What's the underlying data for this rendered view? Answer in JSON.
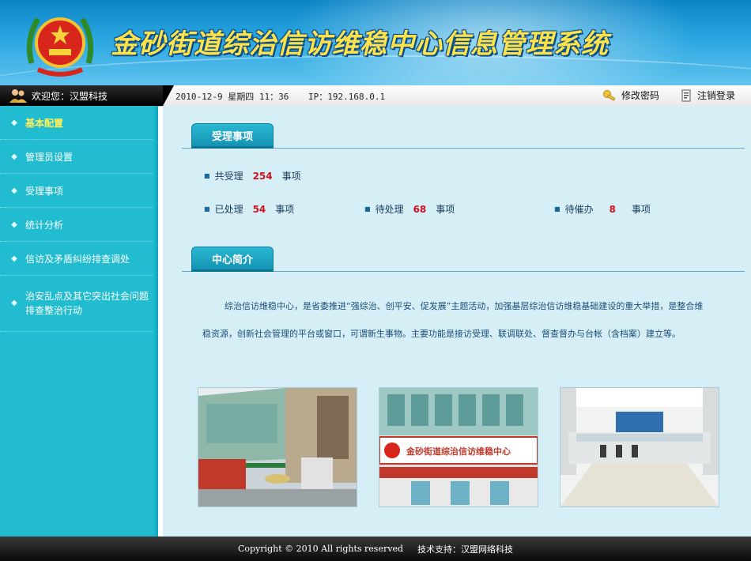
{
  "header": {
    "title": "金砂街道综治信访维稳中心信息管理系统"
  },
  "topbar": {
    "welcome": "欢迎您：汉盟科技",
    "datetime": "2010-12-9 星期四 11：36",
    "ip": "IP：192.168.0.1",
    "change_password": "修改密码",
    "logout": "注销登录"
  },
  "sidebar": {
    "items": [
      {
        "label": "基本配置",
        "active": true
      },
      {
        "label": "管理员设置"
      },
      {
        "label": "受理事项"
      },
      {
        "label": "统计分析"
      },
      {
        "label": "信访及矛盾纠纷排查调处"
      },
      {
        "label": "治安乱点及其它突出社会问题排查整治行动"
      }
    ]
  },
  "main": {
    "section1_title": "受理事项",
    "stats": {
      "total": {
        "prefix": "共受理",
        "value": "254",
        "suffix": "事项"
      },
      "handled": {
        "prefix": "已处理",
        "value": "54",
        "suffix": "事项"
      },
      "pending": {
        "prefix": "待处理",
        "value": "68",
        "suffix": "事项"
      },
      "urged": {
        "prefix": "待催办",
        "value": "8",
        "suffix": "事项"
      }
    },
    "section2_title": "中心简介",
    "intro": "综治信访维稳中心，是省委推进“强综治、创平安、促发展”主题活动，加强基层综治信访维稳基础建设的重大举措，是整合维稳资源，创新社会管理的平台或窗口，可谓新生事物。主要功能是接访受理、联调联处、督查督办与台帐（含档案）建立等。",
    "photo_sign": "金砂街道综治信访维稳中心"
  },
  "footer": {
    "copyright": "Copyright © 2010 All rights reserved",
    "support": "技术支持：汉盟网络科技"
  },
  "colors": {
    "accent": "#1593b3",
    "sidebar": "#21bcd0",
    "highlight_number": "#d3121d",
    "active_menu": "#ffef5a"
  }
}
